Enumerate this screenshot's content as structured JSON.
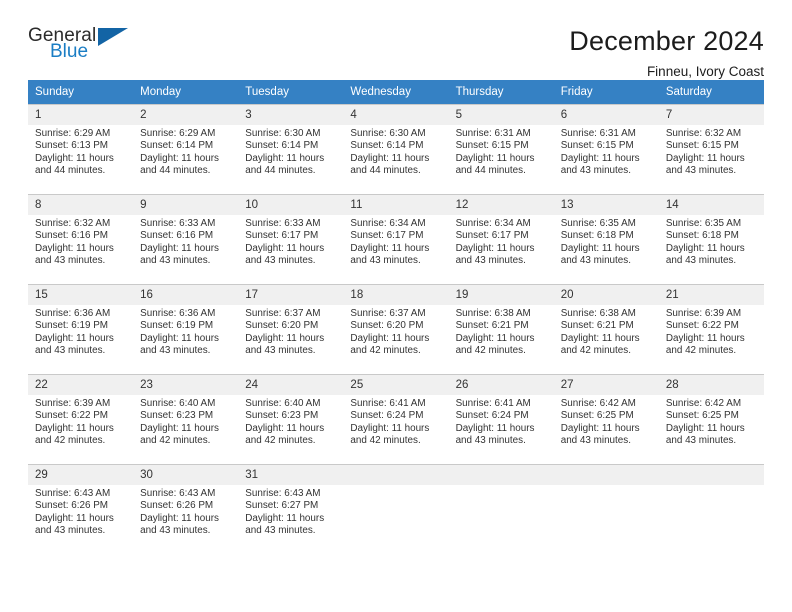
{
  "brand": {
    "name_top": "General",
    "name_bottom": "Blue",
    "triangle_color": "#1364a5",
    "blue_text_color": "#1a7dc4"
  },
  "header": {
    "title": "December 2024",
    "subtitle": "Finneu, Ivory Coast"
  },
  "theme": {
    "header_row_bg": "#3581c4",
    "header_row_text": "#ffffff",
    "daynum_bg": "#f0f0f0",
    "cell_border": "#c9c9c9",
    "body_text": "#333333"
  },
  "calendar": {
    "weekday_headers": [
      "Sunday",
      "Monday",
      "Tuesday",
      "Wednesday",
      "Thursday",
      "Friday",
      "Saturday"
    ],
    "weeks": [
      [
        {
          "day": "1",
          "sunrise": "Sunrise: 6:29 AM",
          "sunset": "Sunset: 6:13 PM",
          "daylight_line1": "Daylight: 11 hours",
          "daylight_line2": "and 44 minutes."
        },
        {
          "day": "2",
          "sunrise": "Sunrise: 6:29 AM",
          "sunset": "Sunset: 6:14 PM",
          "daylight_line1": "Daylight: 11 hours",
          "daylight_line2": "and 44 minutes."
        },
        {
          "day": "3",
          "sunrise": "Sunrise: 6:30 AM",
          "sunset": "Sunset: 6:14 PM",
          "daylight_line1": "Daylight: 11 hours",
          "daylight_line2": "and 44 minutes."
        },
        {
          "day": "4",
          "sunrise": "Sunrise: 6:30 AM",
          "sunset": "Sunset: 6:14 PM",
          "daylight_line1": "Daylight: 11 hours",
          "daylight_line2": "and 44 minutes."
        },
        {
          "day": "5",
          "sunrise": "Sunrise: 6:31 AM",
          "sunset": "Sunset: 6:15 PM",
          "daylight_line1": "Daylight: 11 hours",
          "daylight_line2": "and 44 minutes."
        },
        {
          "day": "6",
          "sunrise": "Sunrise: 6:31 AM",
          "sunset": "Sunset: 6:15 PM",
          "daylight_line1": "Daylight: 11 hours",
          "daylight_line2": "and 43 minutes."
        },
        {
          "day": "7",
          "sunrise": "Sunrise: 6:32 AM",
          "sunset": "Sunset: 6:15 PM",
          "daylight_line1": "Daylight: 11 hours",
          "daylight_line2": "and 43 minutes."
        }
      ],
      [
        {
          "day": "8",
          "sunrise": "Sunrise: 6:32 AM",
          "sunset": "Sunset: 6:16 PM",
          "daylight_line1": "Daylight: 11 hours",
          "daylight_line2": "and 43 minutes."
        },
        {
          "day": "9",
          "sunrise": "Sunrise: 6:33 AM",
          "sunset": "Sunset: 6:16 PM",
          "daylight_line1": "Daylight: 11 hours",
          "daylight_line2": "and 43 minutes."
        },
        {
          "day": "10",
          "sunrise": "Sunrise: 6:33 AM",
          "sunset": "Sunset: 6:17 PM",
          "daylight_line1": "Daylight: 11 hours",
          "daylight_line2": "and 43 minutes."
        },
        {
          "day": "11",
          "sunrise": "Sunrise: 6:34 AM",
          "sunset": "Sunset: 6:17 PM",
          "daylight_line1": "Daylight: 11 hours",
          "daylight_line2": "and 43 minutes."
        },
        {
          "day": "12",
          "sunrise": "Sunrise: 6:34 AM",
          "sunset": "Sunset: 6:17 PM",
          "daylight_line1": "Daylight: 11 hours",
          "daylight_line2": "and 43 minutes."
        },
        {
          "day": "13",
          "sunrise": "Sunrise: 6:35 AM",
          "sunset": "Sunset: 6:18 PM",
          "daylight_line1": "Daylight: 11 hours",
          "daylight_line2": "and 43 minutes."
        },
        {
          "day": "14",
          "sunrise": "Sunrise: 6:35 AM",
          "sunset": "Sunset: 6:18 PM",
          "daylight_line1": "Daylight: 11 hours",
          "daylight_line2": "and 43 minutes."
        }
      ],
      [
        {
          "day": "15",
          "sunrise": "Sunrise: 6:36 AM",
          "sunset": "Sunset: 6:19 PM",
          "daylight_line1": "Daylight: 11 hours",
          "daylight_line2": "and 43 minutes."
        },
        {
          "day": "16",
          "sunrise": "Sunrise: 6:36 AM",
          "sunset": "Sunset: 6:19 PM",
          "daylight_line1": "Daylight: 11 hours",
          "daylight_line2": "and 43 minutes."
        },
        {
          "day": "17",
          "sunrise": "Sunrise: 6:37 AM",
          "sunset": "Sunset: 6:20 PM",
          "daylight_line1": "Daylight: 11 hours",
          "daylight_line2": "and 43 minutes."
        },
        {
          "day": "18",
          "sunrise": "Sunrise: 6:37 AM",
          "sunset": "Sunset: 6:20 PM",
          "daylight_line1": "Daylight: 11 hours",
          "daylight_line2": "and 42 minutes."
        },
        {
          "day": "19",
          "sunrise": "Sunrise: 6:38 AM",
          "sunset": "Sunset: 6:21 PM",
          "daylight_line1": "Daylight: 11 hours",
          "daylight_line2": "and 42 minutes."
        },
        {
          "day": "20",
          "sunrise": "Sunrise: 6:38 AM",
          "sunset": "Sunset: 6:21 PM",
          "daylight_line1": "Daylight: 11 hours",
          "daylight_line2": "and 42 minutes."
        },
        {
          "day": "21",
          "sunrise": "Sunrise: 6:39 AM",
          "sunset": "Sunset: 6:22 PM",
          "daylight_line1": "Daylight: 11 hours",
          "daylight_line2": "and 42 minutes."
        }
      ],
      [
        {
          "day": "22",
          "sunrise": "Sunrise: 6:39 AM",
          "sunset": "Sunset: 6:22 PM",
          "daylight_line1": "Daylight: 11 hours",
          "daylight_line2": "and 42 minutes."
        },
        {
          "day": "23",
          "sunrise": "Sunrise: 6:40 AM",
          "sunset": "Sunset: 6:23 PM",
          "daylight_line1": "Daylight: 11 hours",
          "daylight_line2": "and 42 minutes."
        },
        {
          "day": "24",
          "sunrise": "Sunrise: 6:40 AM",
          "sunset": "Sunset: 6:23 PM",
          "daylight_line1": "Daylight: 11 hours",
          "daylight_line2": "and 42 minutes."
        },
        {
          "day": "25",
          "sunrise": "Sunrise: 6:41 AM",
          "sunset": "Sunset: 6:24 PM",
          "daylight_line1": "Daylight: 11 hours",
          "daylight_line2": "and 42 minutes."
        },
        {
          "day": "26",
          "sunrise": "Sunrise: 6:41 AM",
          "sunset": "Sunset: 6:24 PM",
          "daylight_line1": "Daylight: 11 hours",
          "daylight_line2": "and 43 minutes."
        },
        {
          "day": "27",
          "sunrise": "Sunrise: 6:42 AM",
          "sunset": "Sunset: 6:25 PM",
          "daylight_line1": "Daylight: 11 hours",
          "daylight_line2": "and 43 minutes."
        },
        {
          "day": "28",
          "sunrise": "Sunrise: 6:42 AM",
          "sunset": "Sunset: 6:25 PM",
          "daylight_line1": "Daylight: 11 hours",
          "daylight_line2": "and 43 minutes."
        }
      ],
      [
        {
          "day": "29",
          "sunrise": "Sunrise: 6:43 AM",
          "sunset": "Sunset: 6:26 PM",
          "daylight_line1": "Daylight: 11 hours",
          "daylight_line2": "and 43 minutes."
        },
        {
          "day": "30",
          "sunrise": "Sunrise: 6:43 AM",
          "sunset": "Sunset: 6:26 PM",
          "daylight_line1": "Daylight: 11 hours",
          "daylight_line2": "and 43 minutes."
        },
        {
          "day": "31",
          "sunrise": "Sunrise: 6:43 AM",
          "sunset": "Sunset: 6:27 PM",
          "daylight_line1": "Daylight: 11 hours",
          "daylight_line2": "and 43 minutes."
        },
        {
          "day": "",
          "sunrise": "",
          "sunset": "",
          "daylight_line1": "",
          "daylight_line2": ""
        },
        {
          "day": "",
          "sunrise": "",
          "sunset": "",
          "daylight_line1": "",
          "daylight_line2": ""
        },
        {
          "day": "",
          "sunrise": "",
          "sunset": "",
          "daylight_line1": "",
          "daylight_line2": ""
        },
        {
          "day": "",
          "sunrise": "",
          "sunset": "",
          "daylight_line1": "",
          "daylight_line2": ""
        }
      ]
    ]
  }
}
